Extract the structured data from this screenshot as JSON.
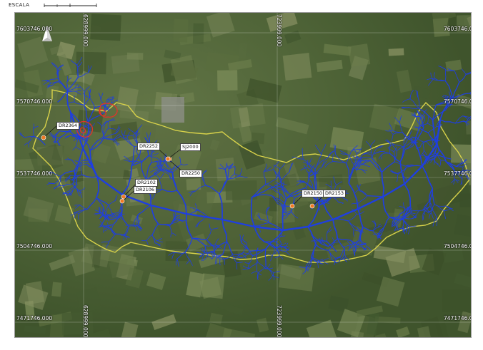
{
  "scale": {
    "label": "ESCALA"
  },
  "grid": {
    "northings": [
      "7603746.000",
      "7570746.000",
      "7537746.000",
      "7504746.000",
      "7471746.000"
    ],
    "eastings": [
      "628999.000",
      "723999.000"
    ]
  },
  "stations": [
    "DR2364",
    "DR2252",
    "SJ2000",
    "DR2250",
    "DR2102",
    "DR2106",
    "DR2150",
    "DR2153"
  ],
  "colors": {
    "rivers": "#1f3fe0",
    "basin_boundary": "#d8d24a",
    "reservoir": "#e0332b",
    "station": "#f07a24",
    "imagery": "#53663a"
  },
  "icons": {
    "north_arrow": "north-arrow-icon"
  }
}
